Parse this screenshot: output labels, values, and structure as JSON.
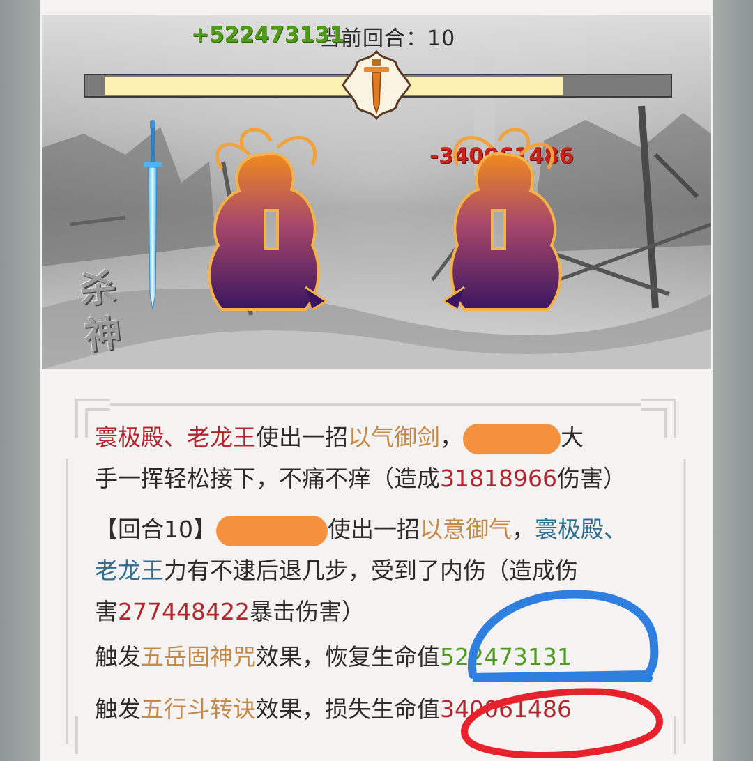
{
  "battle": {
    "round_text": "当前回合：10",
    "floating_heal": "+522473131",
    "floating_damage": "-340061486",
    "hp_fill_fraction": 0.82,
    "side_label": "杀神"
  },
  "log": {
    "entry1": {
      "actor": "寰极殿、老龙王",
      "verb": "使出一招",
      "skill": "以气御剑",
      "sep": "，",
      "rest_a": "大",
      "rest_b": "手一挥轻松接下，不痛不痒（造成",
      "damage": "31818966",
      "tail": "伤害）"
    },
    "entry2": {
      "round_tag": "【回合10】",
      "verb": "使出一招",
      "skill": "以意御气",
      "sep": "，",
      "target_a": "寰极殿、",
      "target_b": "老龙王",
      "rest": "力有不逮后退几步，受到了内伤（造成伤",
      "rest2_a": "害",
      "damage": "277448422",
      "tail": "暴击伤害）"
    },
    "entry3": {
      "prefix": "触发",
      "skill": "五岳固神咒",
      "mid": "效果，恢复生命值",
      "value": "522473131"
    },
    "entry4": {
      "prefix": "触发",
      "skill": "五行斗转诀",
      "mid": "效果，损失生命值",
      "value": "340061486"
    }
  },
  "colors": {
    "name_red": "#b3262d",
    "skill_gold": "#c48a4a",
    "name_blue": "#2f6e93",
    "heal_green": "#4e9c1d",
    "redaction_orange": "#f5913d",
    "annotation_blue": "#2f7fe0",
    "annotation_red": "#e8222c"
  },
  "icons": {
    "emblem": "sword-emblem-icon",
    "weapon": "blue-sword-icon",
    "player": "hero-silhouette-icon",
    "enemy": "hero-silhouette-icon"
  }
}
